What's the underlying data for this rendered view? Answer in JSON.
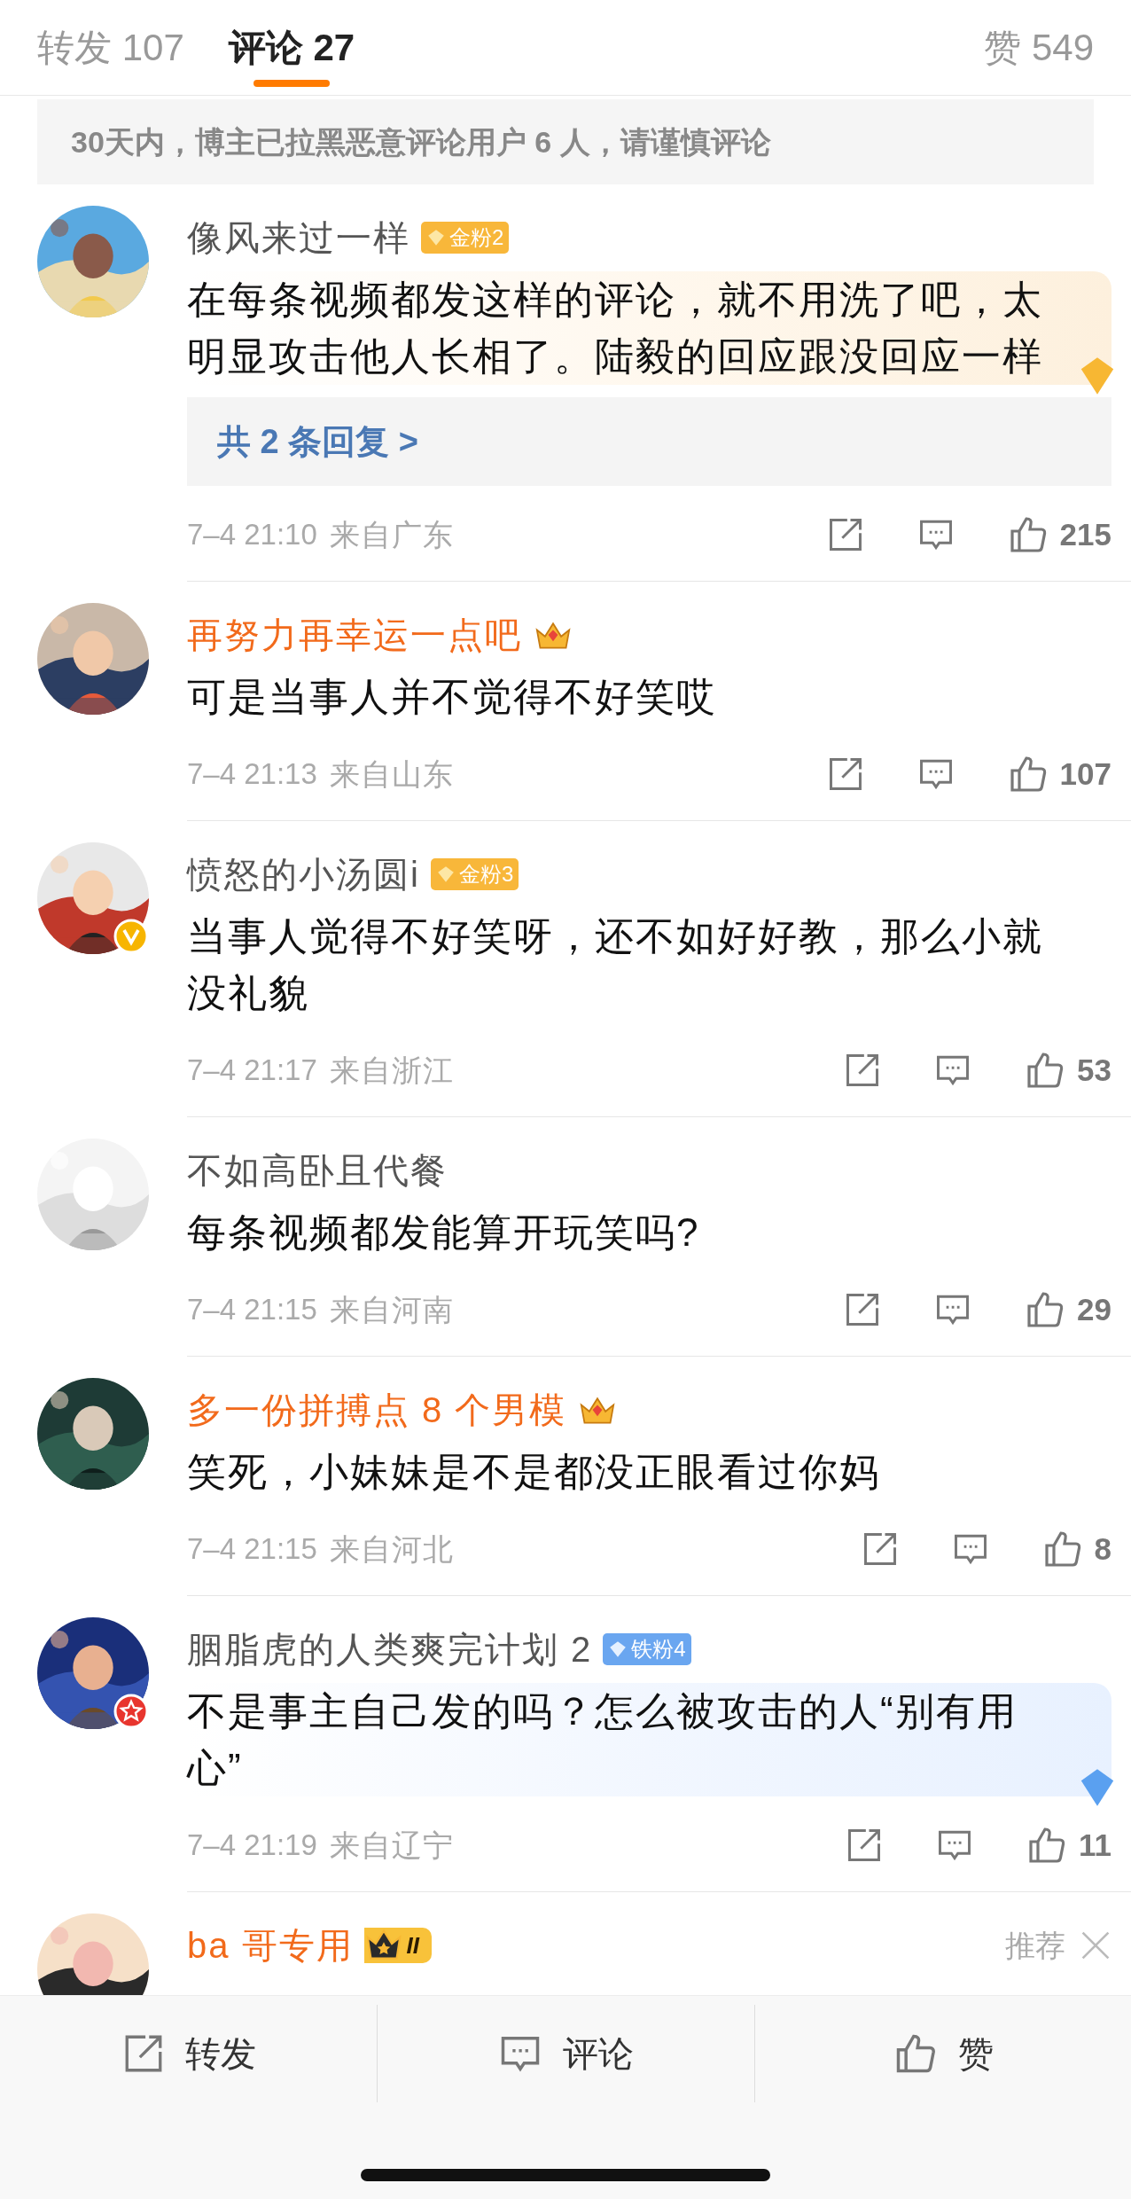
{
  "tabs": [
    {
      "label": "转发",
      "count": "107",
      "selected": false
    },
    {
      "label": "评论",
      "count": "27",
      "selected": true
    },
    {
      "label": "赞",
      "count": "549",
      "selected": false
    }
  ],
  "notice": "30天内，博主已拉黑恶意评论用户 6 人，请谨慎评论",
  "comments": [
    {
      "name": "像风来过一样",
      "vip": false,
      "badge": {
        "kind": "fan-gold",
        "label": "金粉2"
      },
      "text": "在每条视频都发这样的评论，就不用洗了吧，太明显攻击他人长相了。陆毅的回应跟没回应一样",
      "highlighted": true,
      "color": "#f7b733",
      "replies": "共 2 条回复 >",
      "time": "7–4 21:10",
      "location": "来自广东",
      "likes": "215"
    },
    {
      "name": "再努力再幸运一点吧",
      "vip": true,
      "badge": {
        "kind": "crown"
      },
      "text": "可是当事人并不觉得不好笑哎",
      "time": "7–4 21:13",
      "location": "来自山东",
      "likes": "107"
    },
    {
      "name": "愤怒的小汤圆i",
      "vip": false,
      "verified": true,
      "badge": {
        "kind": "fan-gold",
        "label": "金粉3"
      },
      "text": "当事人觉得不好笑呀，还不如好好教，那么小就没礼貌",
      "time": "7–4 21:17",
      "location": "来自浙江",
      "likes": "53"
    },
    {
      "name": "不如高卧且代餐",
      "vip": false,
      "text": "每条视频都发能算开玩笑吗?",
      "time": "7–4 21:15",
      "location": "来自河南",
      "likes": "29"
    },
    {
      "name": "多一份拼搏点 8 个男模",
      "vip": true,
      "badge": {
        "kind": "crown"
      },
      "text": "笑死，小妹妹是不是都没正眼看过你妈",
      "time": "7–4 21:15",
      "location": "来自河北",
      "likes": "8"
    },
    {
      "name": "胭脂虎的人类爽完计划 2",
      "vip": false,
      "starred": true,
      "badge": {
        "kind": "fan-iron",
        "label": "铁粉4"
      },
      "text": "不是事主自己发的吗？怎么被攻击的人“别有用心”",
      "highlighted": true,
      "color": "#5aa0f0",
      "time": "7–4 21:19",
      "location": "来自辽宁",
      "likes": "11"
    },
    {
      "name": "ba 哥专用",
      "vip": true,
      "badge": {
        "kind": "crown-level",
        "label": "II"
      },
      "recommended": "推荐"
    }
  ],
  "footer": [
    {
      "kind": "share",
      "label": "转发"
    },
    {
      "kind": "comment",
      "label": "评论"
    },
    {
      "kind": "like",
      "label": "赞"
    }
  ]
}
